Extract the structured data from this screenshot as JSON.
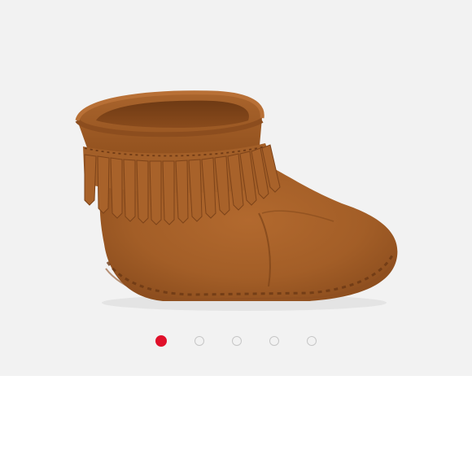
{
  "carousel": {
    "slides": [
      {
        "image": "brown-suede-fringe-baby-bootie-photo"
      }
    ],
    "active_index": 0,
    "dot_count": 5,
    "indicator_colors": {
      "active": "#e0102a",
      "inactive": "#c6c6c6"
    }
  },
  "colors": {
    "background": "#f2f2f2",
    "page": "#ffffff"
  }
}
